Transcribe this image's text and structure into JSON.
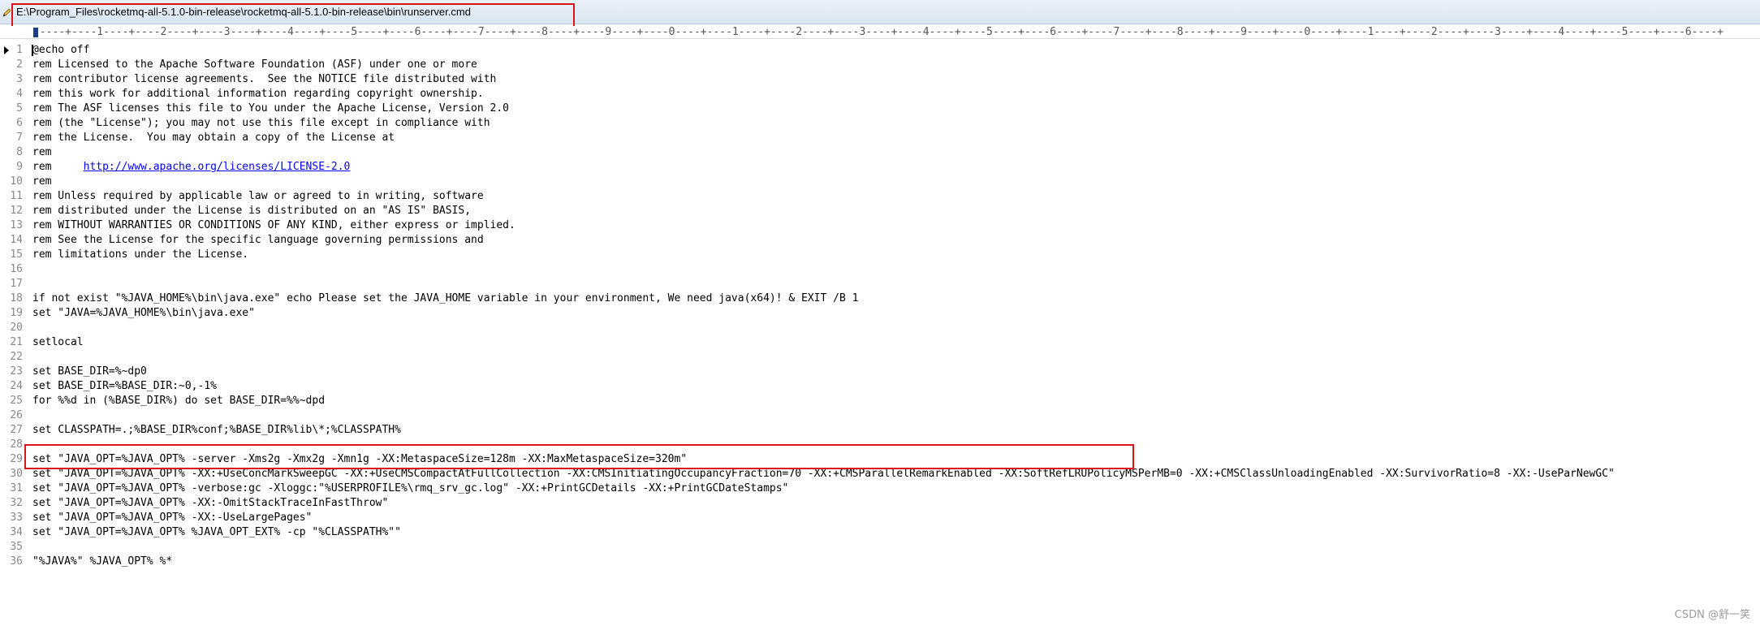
{
  "window": {
    "title": "E:\\Program_Files\\rocketmq-all-5.1.0-bin-release\\rocketmq-all-5.1.0-bin-release\\bin\\runserver.cmd",
    "icon": "pencil-icon"
  },
  "ruler": {
    "text": "-----+----1----+----2----+----3----+----4----+----5----+----6----+----7----+----8----+----9----+----0----+----1----+----2----+----3----+----4----+----5----+----6----+----7----+----8----+----9----+----0----+----1----+----2----+----3----+----4----+----5----+----6----+"
  },
  "editor": {
    "current_line": 1,
    "lines": [
      {
        "num": "1",
        "text": "@echo off"
      },
      {
        "num": "2",
        "text": "rem Licensed to the Apache Software Foundation (ASF) under one or more"
      },
      {
        "num": "3",
        "text": "rem contributor license agreements.  See the NOTICE file distributed with"
      },
      {
        "num": "4",
        "text": "rem this work for additional information regarding copyright ownership."
      },
      {
        "num": "5",
        "text": "rem The ASF licenses this file to You under the Apache License, Version 2.0"
      },
      {
        "num": "6",
        "text": "rem (the \"License\"); you may not use this file except in compliance with"
      },
      {
        "num": "7",
        "text": "rem the License.  You may obtain a copy of the License at"
      },
      {
        "num": "8",
        "text": "rem"
      },
      {
        "num": "9",
        "text": "rem     ",
        "link": "http://www.apache.org/licenses/LICENSE-2.0"
      },
      {
        "num": "10",
        "text": "rem"
      },
      {
        "num": "11",
        "text": "rem Unless required by applicable law or agreed to in writing, software"
      },
      {
        "num": "12",
        "text": "rem distributed under the License is distributed on an \"AS IS\" BASIS,"
      },
      {
        "num": "13",
        "text": "rem WITHOUT WARRANTIES OR CONDITIONS OF ANY KIND, either express or implied."
      },
      {
        "num": "14",
        "text": "rem See the License for the specific language governing permissions and"
      },
      {
        "num": "15",
        "text": "rem limitations under the License."
      },
      {
        "num": "16",
        "text": ""
      },
      {
        "num": "17",
        "text": ""
      },
      {
        "num": "18",
        "text": "if not exist \"%JAVA_HOME%\\bin\\java.exe\" echo Please set the JAVA_HOME variable in your environment, We need java(x64)! & EXIT /B 1"
      },
      {
        "num": "19",
        "text": "set \"JAVA=%JAVA_HOME%\\bin\\java.exe\""
      },
      {
        "num": "20",
        "text": ""
      },
      {
        "num": "21",
        "text": "setlocal"
      },
      {
        "num": "22",
        "text": ""
      },
      {
        "num": "23",
        "text": "set BASE_DIR=%~dp0"
      },
      {
        "num": "24",
        "text": "set BASE_DIR=%BASE_DIR:~0,-1%"
      },
      {
        "num": "25",
        "text": "for %%d in (%BASE_DIR%) do set BASE_DIR=%%~dpd"
      },
      {
        "num": "26",
        "text": ""
      },
      {
        "num": "27",
        "text": "set CLASSPATH=.;%BASE_DIR%conf;%BASE_DIR%lib\\*;%CLASSPATH%"
      },
      {
        "num": "28",
        "text": ""
      },
      {
        "num": "29",
        "text": "set \"JAVA_OPT=%JAVA_OPT% -server -Xms2g -Xmx2g -Xmn1g -XX:MetaspaceSize=128m -XX:MaxMetaspaceSize=320m\""
      },
      {
        "num": "30",
        "text": "set \"JAVA_OPT=%JAVA_OPT% -XX:+UseConcMarkSweepGC -XX:+UseCMSCompactAtFullCollection -XX:CMSInitiatingOccupancyFraction=70 -XX:+CMSParallelRemarkEnabled -XX:SoftRefLRUPolicyMSPerMB=0 -XX:+CMSClassUnloadingEnabled -XX:SurvivorRatio=8 -XX:-UseParNewGC\""
      },
      {
        "num": "31",
        "text": "set \"JAVA_OPT=%JAVA_OPT% -verbose:gc -Xloggc:\"%USERPROFILE%\\rmq_srv_gc.log\" -XX:+PrintGCDetails -XX:+PrintGCDateStamps\""
      },
      {
        "num": "32",
        "text": "set \"JAVA_OPT=%JAVA_OPT% -XX:-OmitStackTraceInFastThrow\""
      },
      {
        "num": "33",
        "text": "set \"JAVA_OPT=%JAVA_OPT% -XX:-UseLargePages\""
      },
      {
        "num": "34",
        "text": "set \"JAVA_OPT=%JAVA_OPT% %JAVA_OPT_EXT% -cp \"%CLASSPATH%\"\""
      },
      {
        "num": "35",
        "text": ""
      },
      {
        "num": "36",
        "text": "\"%JAVA%\" %JAVA_OPT% %*"
      }
    ]
  },
  "watermark": "CSDN @舒一笑",
  "colors": {
    "highlight_box": "#d9151b",
    "link": "#0000ee",
    "line_number": "#888888",
    "titlebar": "#dbe6f3"
  }
}
